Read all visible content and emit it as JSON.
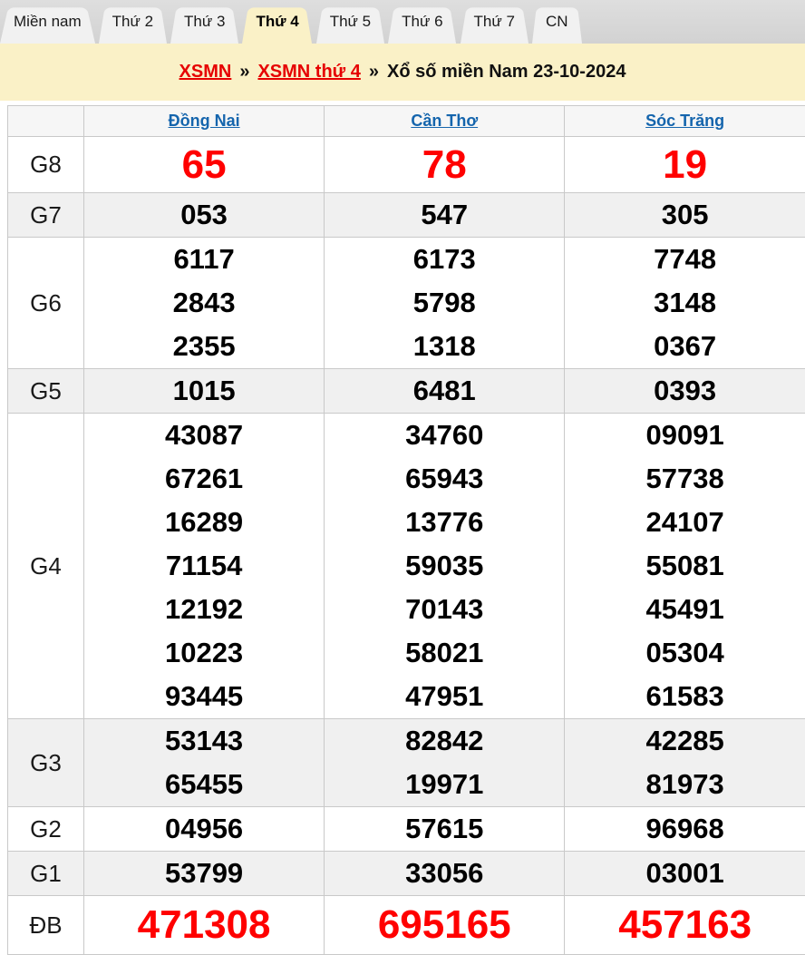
{
  "tabs": [
    {
      "label": "Miền nam",
      "active": false
    },
    {
      "label": "Thứ 2",
      "active": false
    },
    {
      "label": "Thứ 3",
      "active": false
    },
    {
      "label": "Thứ 4",
      "active": true
    },
    {
      "label": "Thứ 5",
      "active": false
    },
    {
      "label": "Thứ 6",
      "active": false
    },
    {
      "label": "Thứ 7",
      "active": false
    },
    {
      "label": "CN",
      "active": false
    }
  ],
  "breadcrumb": {
    "links": [
      "XSMN",
      "XSMN thứ 4"
    ],
    "separator": "»",
    "current": "Xổ số miền Nam 23-10-2024"
  },
  "table": {
    "provinces": [
      "Đồng Nai",
      "Cần Thơ",
      "Sóc Trăng"
    ],
    "rows": [
      {
        "label": "G8",
        "highlight": true,
        "shaded": false,
        "values": [
          [
            "65"
          ],
          [
            "78"
          ],
          [
            "19"
          ]
        ]
      },
      {
        "label": "G7",
        "highlight": false,
        "shaded": true,
        "values": [
          [
            "053"
          ],
          [
            "547"
          ],
          [
            "305"
          ]
        ]
      },
      {
        "label": "G6",
        "highlight": false,
        "shaded": false,
        "values": [
          [
            "6117",
            "2843",
            "2355"
          ],
          [
            "6173",
            "5798",
            "1318"
          ],
          [
            "7748",
            "3148",
            "0367"
          ]
        ]
      },
      {
        "label": "G5",
        "highlight": false,
        "shaded": true,
        "values": [
          [
            "1015"
          ],
          [
            "6481"
          ],
          [
            "0393"
          ]
        ]
      },
      {
        "label": "G4",
        "highlight": false,
        "shaded": false,
        "values": [
          [
            "43087",
            "67261",
            "16289",
            "71154",
            "12192",
            "10223",
            "93445"
          ],
          [
            "34760",
            "65943",
            "13776",
            "59035",
            "70143",
            "58021",
            "47951"
          ],
          [
            "09091",
            "57738",
            "24107",
            "55081",
            "45491",
            "05304",
            "61583"
          ]
        ]
      },
      {
        "label": "G3",
        "highlight": false,
        "shaded": true,
        "values": [
          [
            "53143",
            "65455"
          ],
          [
            "82842",
            "19971"
          ],
          [
            "42285",
            "81973"
          ]
        ]
      },
      {
        "label": "G2",
        "highlight": false,
        "shaded": false,
        "values": [
          [
            "04956"
          ],
          [
            "57615"
          ],
          [
            "96968"
          ]
        ]
      },
      {
        "label": "G1",
        "highlight": false,
        "shaded": true,
        "values": [
          [
            "53799"
          ],
          [
            "33056"
          ],
          [
            "03001"
          ]
        ]
      },
      {
        "label": "ĐB",
        "highlight": true,
        "shaded": false,
        "values": [
          [
            "471308"
          ],
          [
            "695165"
          ],
          [
            "457163"
          ]
        ]
      }
    ]
  },
  "colors": {
    "banner_yellow": "#faf1c7",
    "tab_gray": "#f1f1f1",
    "tabbar_background": "#d5d5d5",
    "breadcrumb_link_red": "#e60000",
    "highlight_number_red": "#ff0000",
    "province_link_blue": "#1565ad",
    "shaded_row_gray": "#f0f0f0",
    "border_gray": "#c9c9c9"
  }
}
